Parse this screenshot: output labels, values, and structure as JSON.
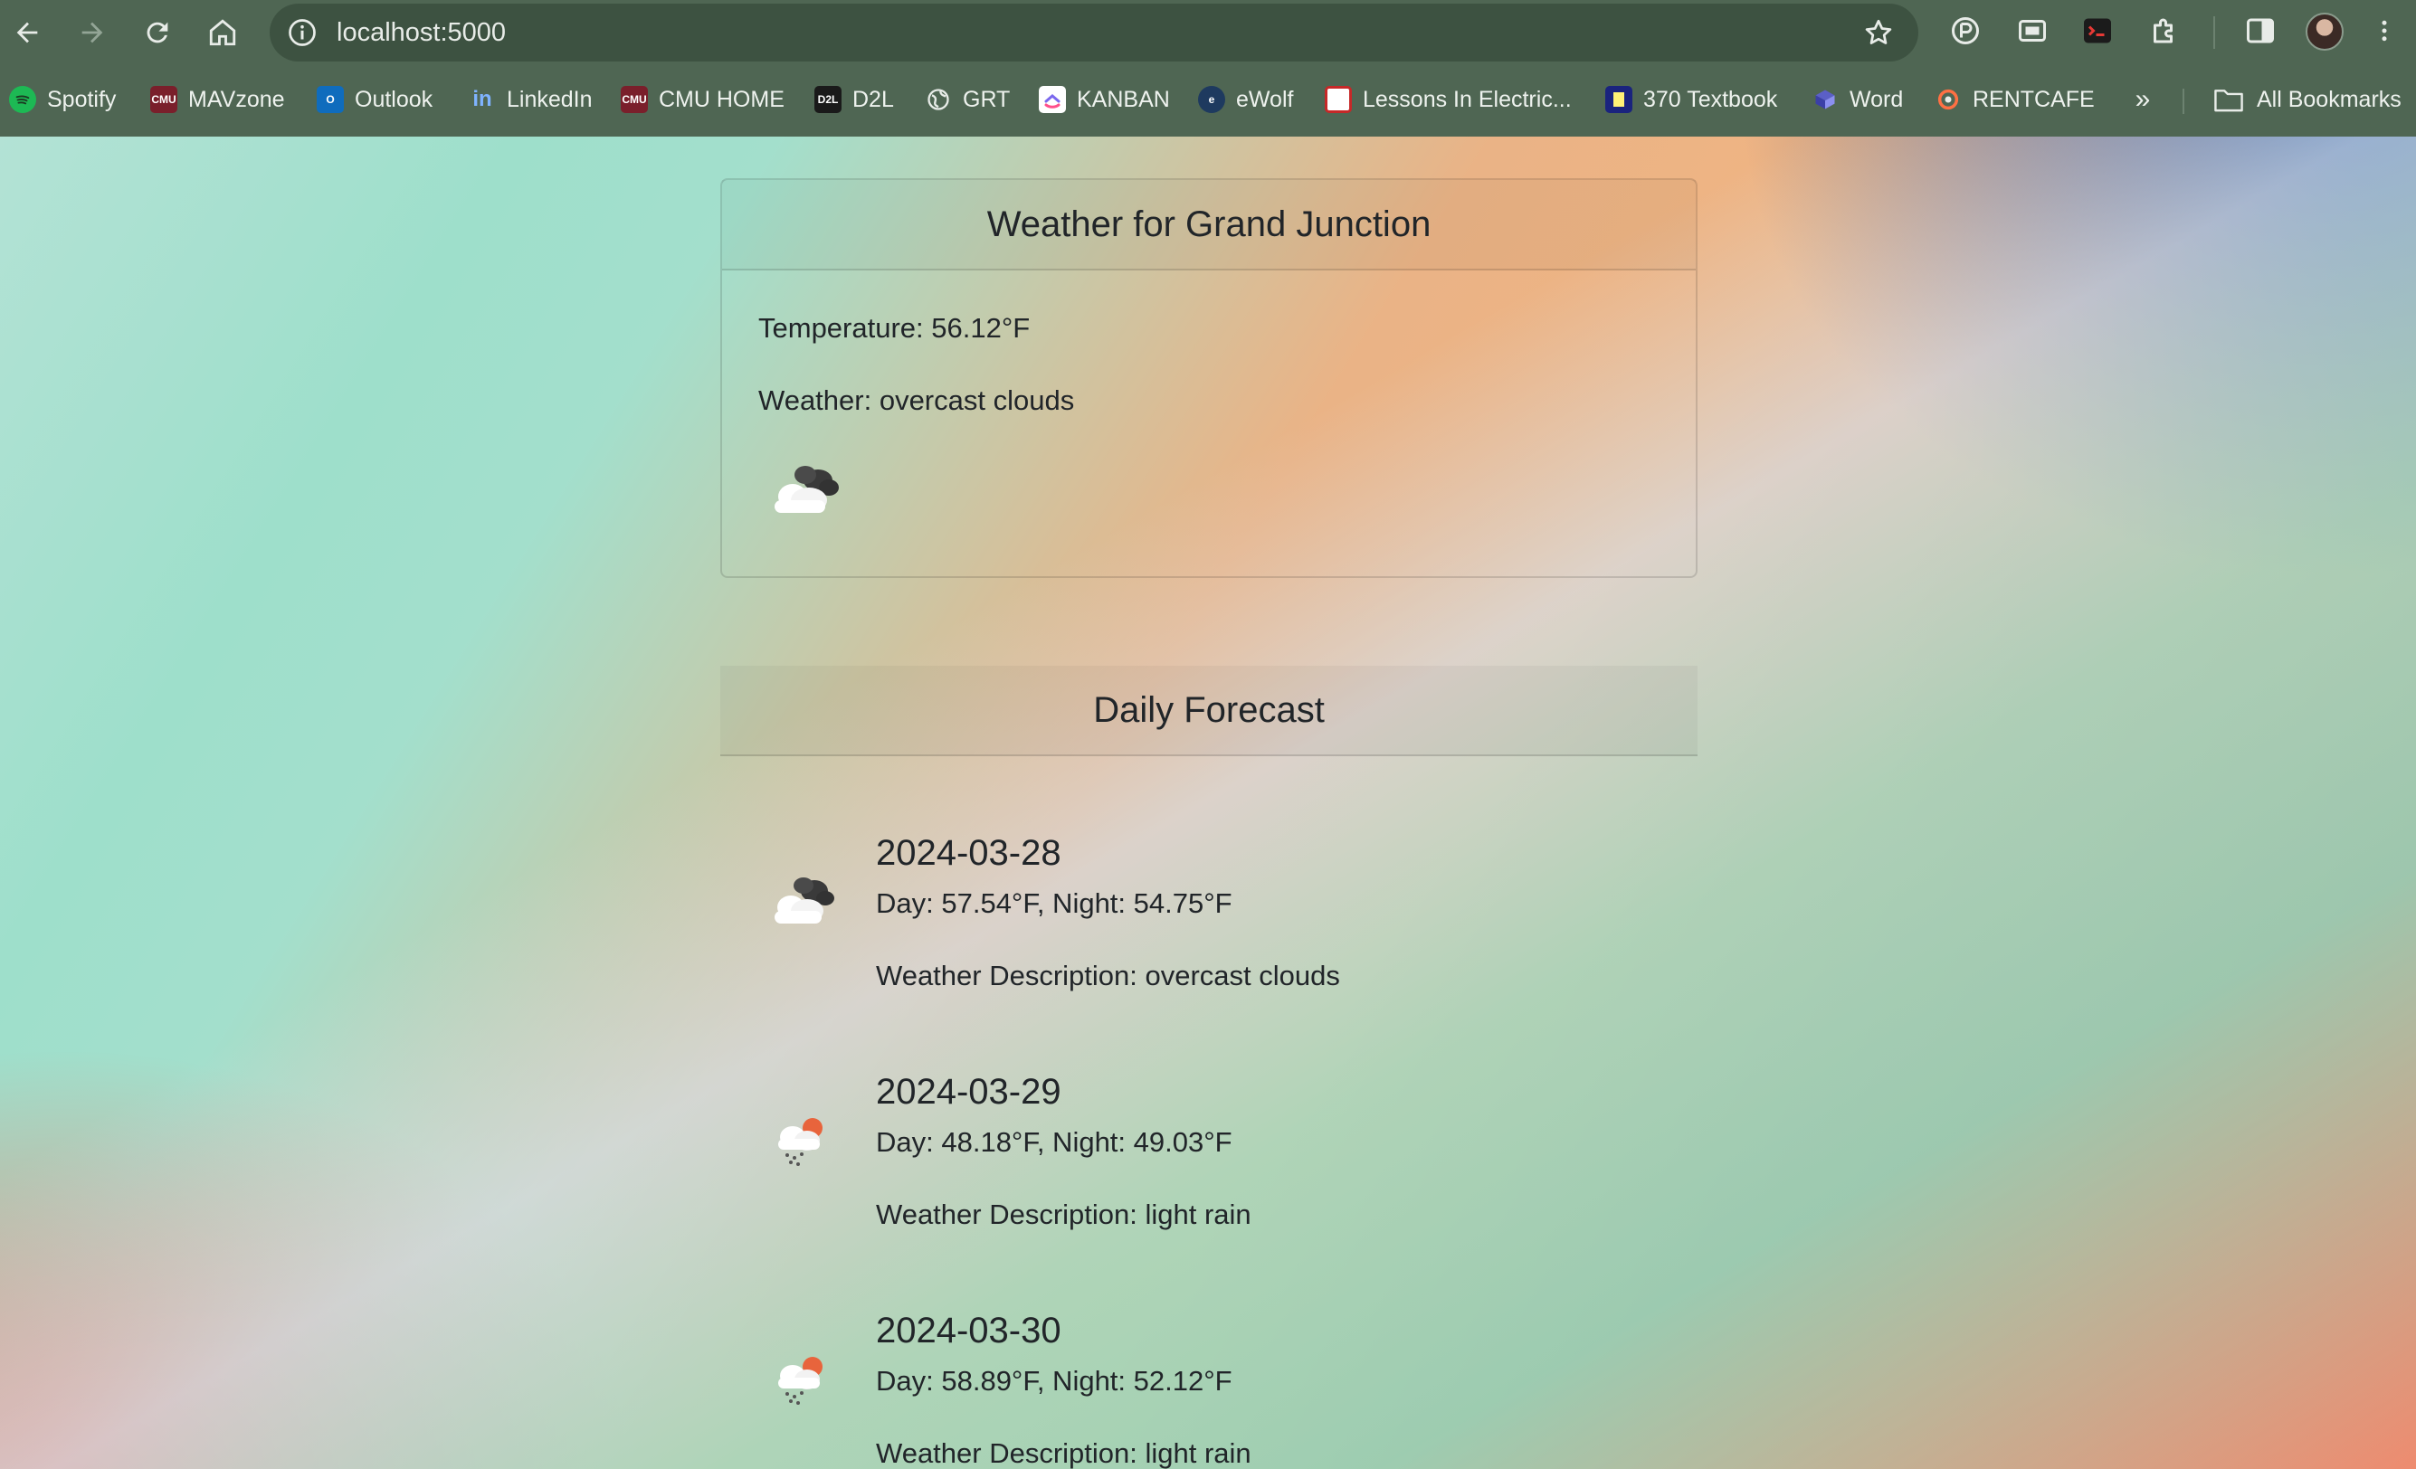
{
  "browser": {
    "url": "localhost:5000",
    "bookmarks": [
      {
        "label": "Spotify",
        "icon": "spotify-icon",
        "color": "#1db954"
      },
      {
        "label": "MAVzone",
        "icon": "cmu-icon",
        "color": "#7a1f2b"
      },
      {
        "label": "Outlook",
        "icon": "outlook-icon",
        "color": "#0f6cbd"
      },
      {
        "label": "LinkedIn",
        "icon": "linkedin-icon",
        "color": "#0a66c2"
      },
      {
        "label": "CMU HOME",
        "icon": "cmu-icon",
        "color": "#7a1f2b"
      },
      {
        "label": "D2L",
        "icon": "d2l-icon",
        "color": "#1a1a1a"
      },
      {
        "label": "GRT",
        "icon": "globe-icon",
        "color": "#e8ece8"
      },
      {
        "label": "KANBAN",
        "icon": "clickup-icon",
        "color": "#7b68ee"
      },
      {
        "label": "eWolf",
        "icon": "ewolf-icon",
        "color": "#1e3a5f"
      },
      {
        "label": "Lessons In Electric...",
        "icon": "lessons-icon",
        "color": "#c62828"
      },
      {
        "label": "370 Textbook",
        "icon": "textbook-icon",
        "color": "#1a237e"
      },
      {
        "label": "Word",
        "icon": "word-icon",
        "color": "#5b5fc7"
      },
      {
        "label": "RENTCAFE",
        "icon": "rentcafe-icon",
        "color": "#e65100"
      }
    ],
    "all_bookmarks_label": "All Bookmarks",
    "more_label": "»"
  },
  "current": {
    "title": "Weather for Grand Junction",
    "temperature": "Temperature: 56.12°F",
    "weather": "Weather: overcast clouds",
    "icon": "overcast-clouds-icon"
  },
  "forecast": {
    "title": "Daily Forecast",
    "days": [
      {
        "date": "2024-03-28",
        "temps": "Day: 57.54°F, Night: 54.75°F",
        "description": "Weather Description: overcast clouds",
        "icon": "overcast-clouds-icon"
      },
      {
        "date": "2024-03-29",
        "temps": "Day: 48.18°F, Night: 49.03°F",
        "description": "Weather Description: light rain",
        "icon": "light-rain-icon"
      },
      {
        "date": "2024-03-30",
        "temps": "Day: 58.89°F, Night: 52.12°F",
        "description": "Weather Description: light rain",
        "icon": "light-rain-icon"
      }
    ]
  },
  "colors": {
    "chrome": "#4f6653",
    "omnibox": "#3d5241",
    "text": "#212529"
  }
}
